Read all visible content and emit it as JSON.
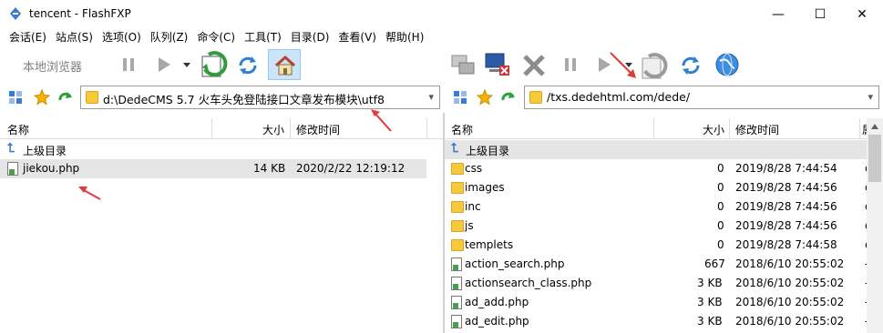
{
  "window": {
    "title": "tencent - FlashFXP",
    "controls": {
      "minimize": "—",
      "maximize": "☐",
      "close": "✕"
    }
  },
  "menu": [
    "会话(E)",
    "站点(S)",
    "选项(O)",
    "队列(Z)",
    "命令(C)",
    "工具(T)",
    "目录(D)",
    "查看(V)",
    "帮助(H)"
  ],
  "left": {
    "toolbar": {
      "browse_label": "本地浏览器"
    },
    "address": "d:\\DedeCMS 5.7 火车头免登陆接口文章发布模块\\utf8",
    "columns": {
      "name": "名称",
      "size": "大小",
      "modified": "修改时间"
    },
    "parent": "上级目录",
    "files": [
      {
        "name": "jiekou.php",
        "size": "14 KB",
        "modified": "2020/2/22 12:19:12"
      }
    ]
  },
  "right": {
    "address": "/txs.dedehtml.com/dede/",
    "columns": {
      "name": "名称",
      "size": "大小",
      "modified": "修改时间",
      "attr": "属"
    },
    "parent": "上级目录",
    "files": [
      {
        "type": "folder",
        "name": "css",
        "size": "0",
        "modified": "2019/8/28 7:44:54",
        "attr": "d"
      },
      {
        "type": "folder",
        "name": "images",
        "size": "0",
        "modified": "2019/8/28 7:44:56",
        "attr": "d"
      },
      {
        "type": "folder",
        "name": "inc",
        "size": "0",
        "modified": "2019/8/28 7:44:56",
        "attr": "d"
      },
      {
        "type": "folder",
        "name": "js",
        "size": "0",
        "modified": "2019/8/28 7:44:56",
        "attr": "d"
      },
      {
        "type": "folder",
        "name": "templets",
        "size": "0",
        "modified": "2019/8/28 7:44:58",
        "attr": "d"
      },
      {
        "type": "file",
        "name": "action_search.php",
        "size": "667",
        "modified": "2018/6/10 20:55:02",
        "attr": "-"
      },
      {
        "type": "file",
        "name": "actionsearch_class.php",
        "size": "3 KB",
        "modified": "2018/6/10 20:55:02",
        "attr": "-"
      },
      {
        "type": "file",
        "name": "ad_add.php",
        "size": "3 KB",
        "modified": "2018/6/10 20:55:02",
        "attr": "-"
      },
      {
        "type": "file",
        "name": "ad_edit.php",
        "size": "3 KB",
        "modified": "2018/6/10 20:55:02",
        "attr": "-"
      }
    ]
  },
  "colors": {
    "accent": "#3a7bd5",
    "selected_row": "#e5e5e5",
    "annotation_arrow": "#e53935"
  }
}
